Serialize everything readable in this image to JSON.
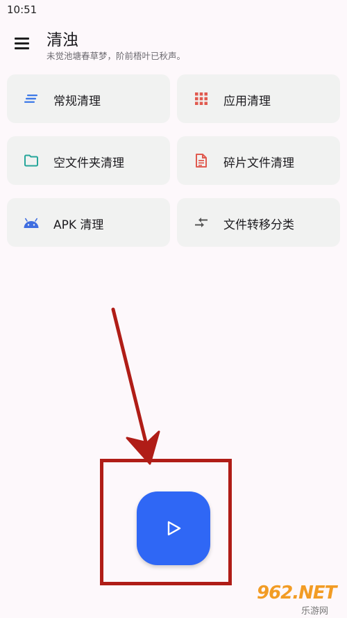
{
  "status_bar": {
    "time": "10:51"
  },
  "header": {
    "title": "清浊",
    "subtitle": "未觉池塘春草梦，阶前梧叶已秋声。",
    "menu_icon": "hamburger-menu-icon"
  },
  "cards": [
    {
      "label": "常规清理",
      "icon": "lines-icon",
      "color": "#3b78e7"
    },
    {
      "label": "应用清理",
      "icon": "apps-grid-icon",
      "color": "#e05a4f"
    },
    {
      "label": "空文件夹清理",
      "icon": "folder-icon",
      "color": "#26a69a"
    },
    {
      "label": "碎片文件清理",
      "icon": "document-icon",
      "color": "#e05a4f"
    },
    {
      "label": "APK 清理",
      "icon": "android-icon",
      "color": "#3f6ee0"
    },
    {
      "label": "文件转移分类",
      "icon": "swap-arrows-icon",
      "color": "#555555"
    }
  ],
  "fab": {
    "icon": "play-icon",
    "color": "#2f67f5"
  },
  "annotation": {
    "color": "#b01d17"
  },
  "watermark": {
    "main": "962.NET",
    "sub": "乐游网"
  }
}
